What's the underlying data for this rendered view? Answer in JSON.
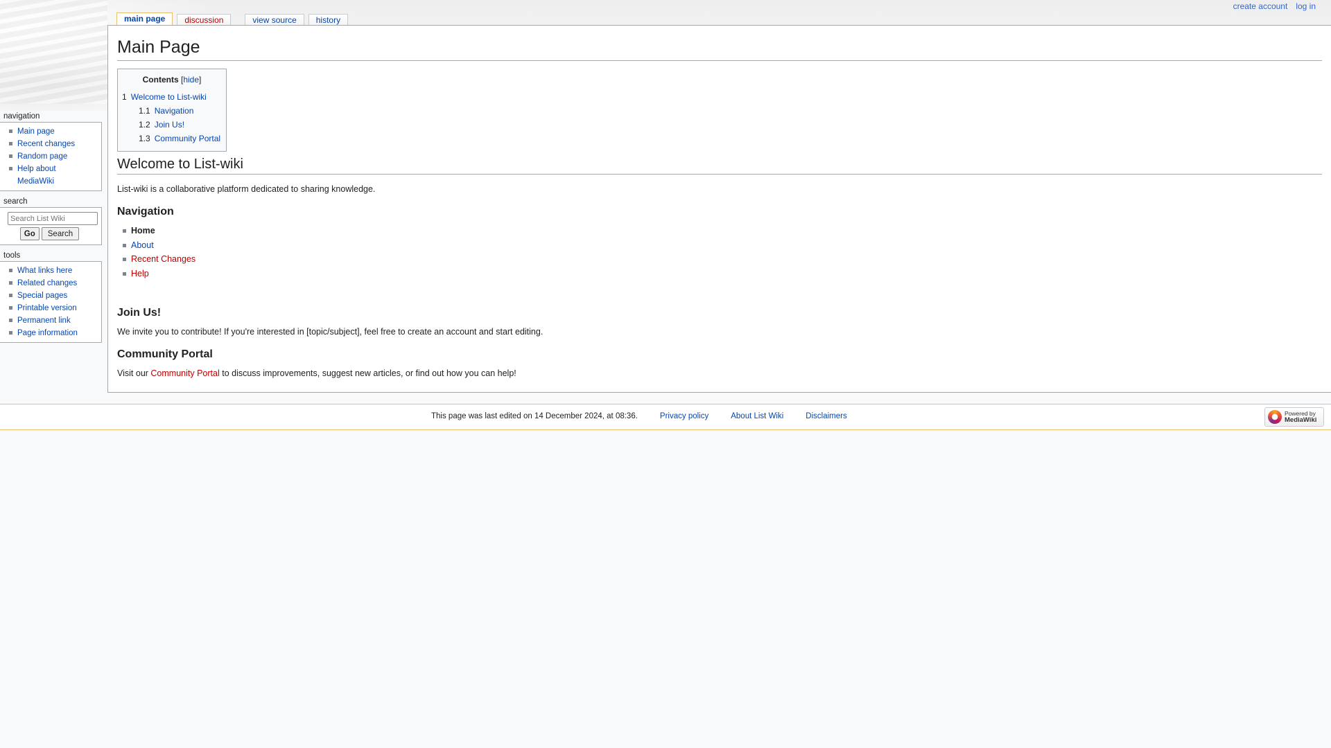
{
  "personal_tools": {
    "create_account": "create account",
    "log_in": "log in"
  },
  "tabs": {
    "main_page": "main page",
    "discussion": "discussion",
    "view_source": "view source",
    "history": "history"
  },
  "page": {
    "title": "Main Page",
    "toc": {
      "title": "Contents",
      "hide_open": "[",
      "hide": "hide",
      "hide_close": "]",
      "items": [
        {
          "num": "1",
          "label": "Welcome to List-wiki"
        },
        {
          "num": "1.1",
          "label": "Navigation"
        },
        {
          "num": "1.2",
          "label": "Join Us!"
        },
        {
          "num": "1.3",
          "label": "Community Portal"
        }
      ]
    },
    "welcome": {
      "heading": "Welcome to List-wiki",
      "text": "List-wiki is a collaborative platform dedicated to sharing knowledge."
    },
    "navigation": {
      "heading": "Navigation",
      "items": [
        {
          "label": "Home",
          "state": "current"
        },
        {
          "label": "About",
          "state": "link"
        },
        {
          "label": "Recent Changes",
          "state": "missing"
        },
        {
          "label": "Help",
          "state": "missing"
        }
      ]
    },
    "join": {
      "heading": "Join Us!",
      "text": "We invite you to contribute! If you're interested in [topic/subject], feel free to create an account and start editing."
    },
    "portal": {
      "heading": "Community Portal",
      "text_before": "Visit our ",
      "link": "Community Portal",
      "text_after": " to discuss improvements, suggest new articles, or find out how you can help!"
    }
  },
  "sidebar": {
    "navigation": {
      "heading": "navigation",
      "items": [
        "Main page",
        "Recent changes",
        "Random page",
        "Help about MediaWiki"
      ]
    },
    "search": {
      "heading": "search",
      "placeholder": "Search List Wiki",
      "go": "Go",
      "search": "Search"
    },
    "tools": {
      "heading": "tools",
      "items": [
        "What links here",
        "Related changes",
        "Special pages",
        "Printable version",
        "Permanent link",
        "Page information"
      ]
    }
  },
  "footer": {
    "last_edited": "This page was last edited on 14 December 2024, at 08:36.",
    "links": [
      "Privacy policy",
      "About List Wiki",
      "Disclaimers"
    ],
    "powered_line1": "Powered by",
    "powered_line2": "MediaWiki"
  },
  "colors": {
    "link": "#0645ad",
    "missing_link": "#ba0000",
    "footer_border": "#e9c46a",
    "selected_tab_border": "#e8c070"
  }
}
